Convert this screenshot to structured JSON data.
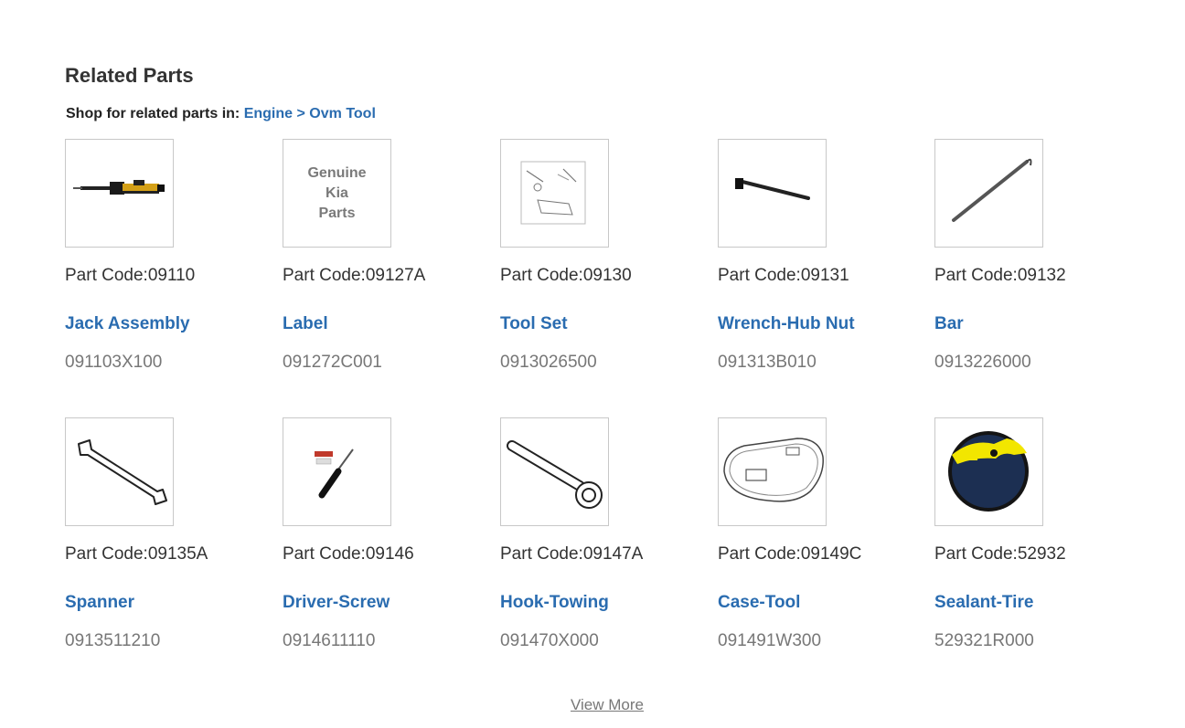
{
  "section": {
    "title": "Related Parts",
    "shop_prefix": "Shop for related parts in:",
    "crumb_engine": "Engine",
    "crumb_sep": ">",
    "crumb_tool": "Ovm Tool"
  },
  "parts": [
    {
      "code_prefix": "Part Code:",
      "code": "09110",
      "name": "Jack Assembly",
      "part_number": "091103X100",
      "image": "jack-icon"
    },
    {
      "code_prefix": "Part Code:",
      "code": "09127A",
      "name": "Label",
      "part_number": "091272C001",
      "image": "genuine-kia-placeholder",
      "placeholder_lines": [
        "Genuine",
        "Kia",
        "Parts"
      ]
    },
    {
      "code_prefix": "Part Code:",
      "code": "09130",
      "name": "Tool Set",
      "part_number": "0913026500",
      "image": "tool-set-diagram-icon"
    },
    {
      "code_prefix": "Part Code:",
      "code": "09131",
      "name": "Wrench-Hub Nut",
      "part_number": "091313B010",
      "image": "hub-wrench-icon"
    },
    {
      "code_prefix": "Part Code:",
      "code": "09132",
      "name": "Bar",
      "part_number": "0913226000",
      "image": "bar-icon"
    },
    {
      "code_prefix": "Part Code:",
      "code": "09135A",
      "name": "Spanner",
      "part_number": "0913511210",
      "image": "spanner-icon"
    },
    {
      "code_prefix": "Part Code:",
      "code": "09146",
      "name": "Driver-Screw",
      "part_number": "0914611110",
      "image": "screwdriver-icon"
    },
    {
      "code_prefix": "Part Code:",
      "code": "09147A",
      "name": "Hook-Towing",
      "part_number": "091470X000",
      "image": "tow-hook-icon"
    },
    {
      "code_prefix": "Part Code:",
      "code": "09149C",
      "name": "Case-Tool",
      "part_number": "091491W300",
      "image": "tool-case-icon"
    },
    {
      "code_prefix": "Part Code:",
      "code": "52932",
      "name": "Sealant-Tire",
      "part_number": "529321R000",
      "image": "tire-sealant-icon"
    }
  ],
  "footer": {
    "view_more": "View More"
  },
  "colors": {
    "link": "#2a6cb0",
    "text": "#333333",
    "muted": "#777777",
    "border": "#c8c8c8"
  }
}
